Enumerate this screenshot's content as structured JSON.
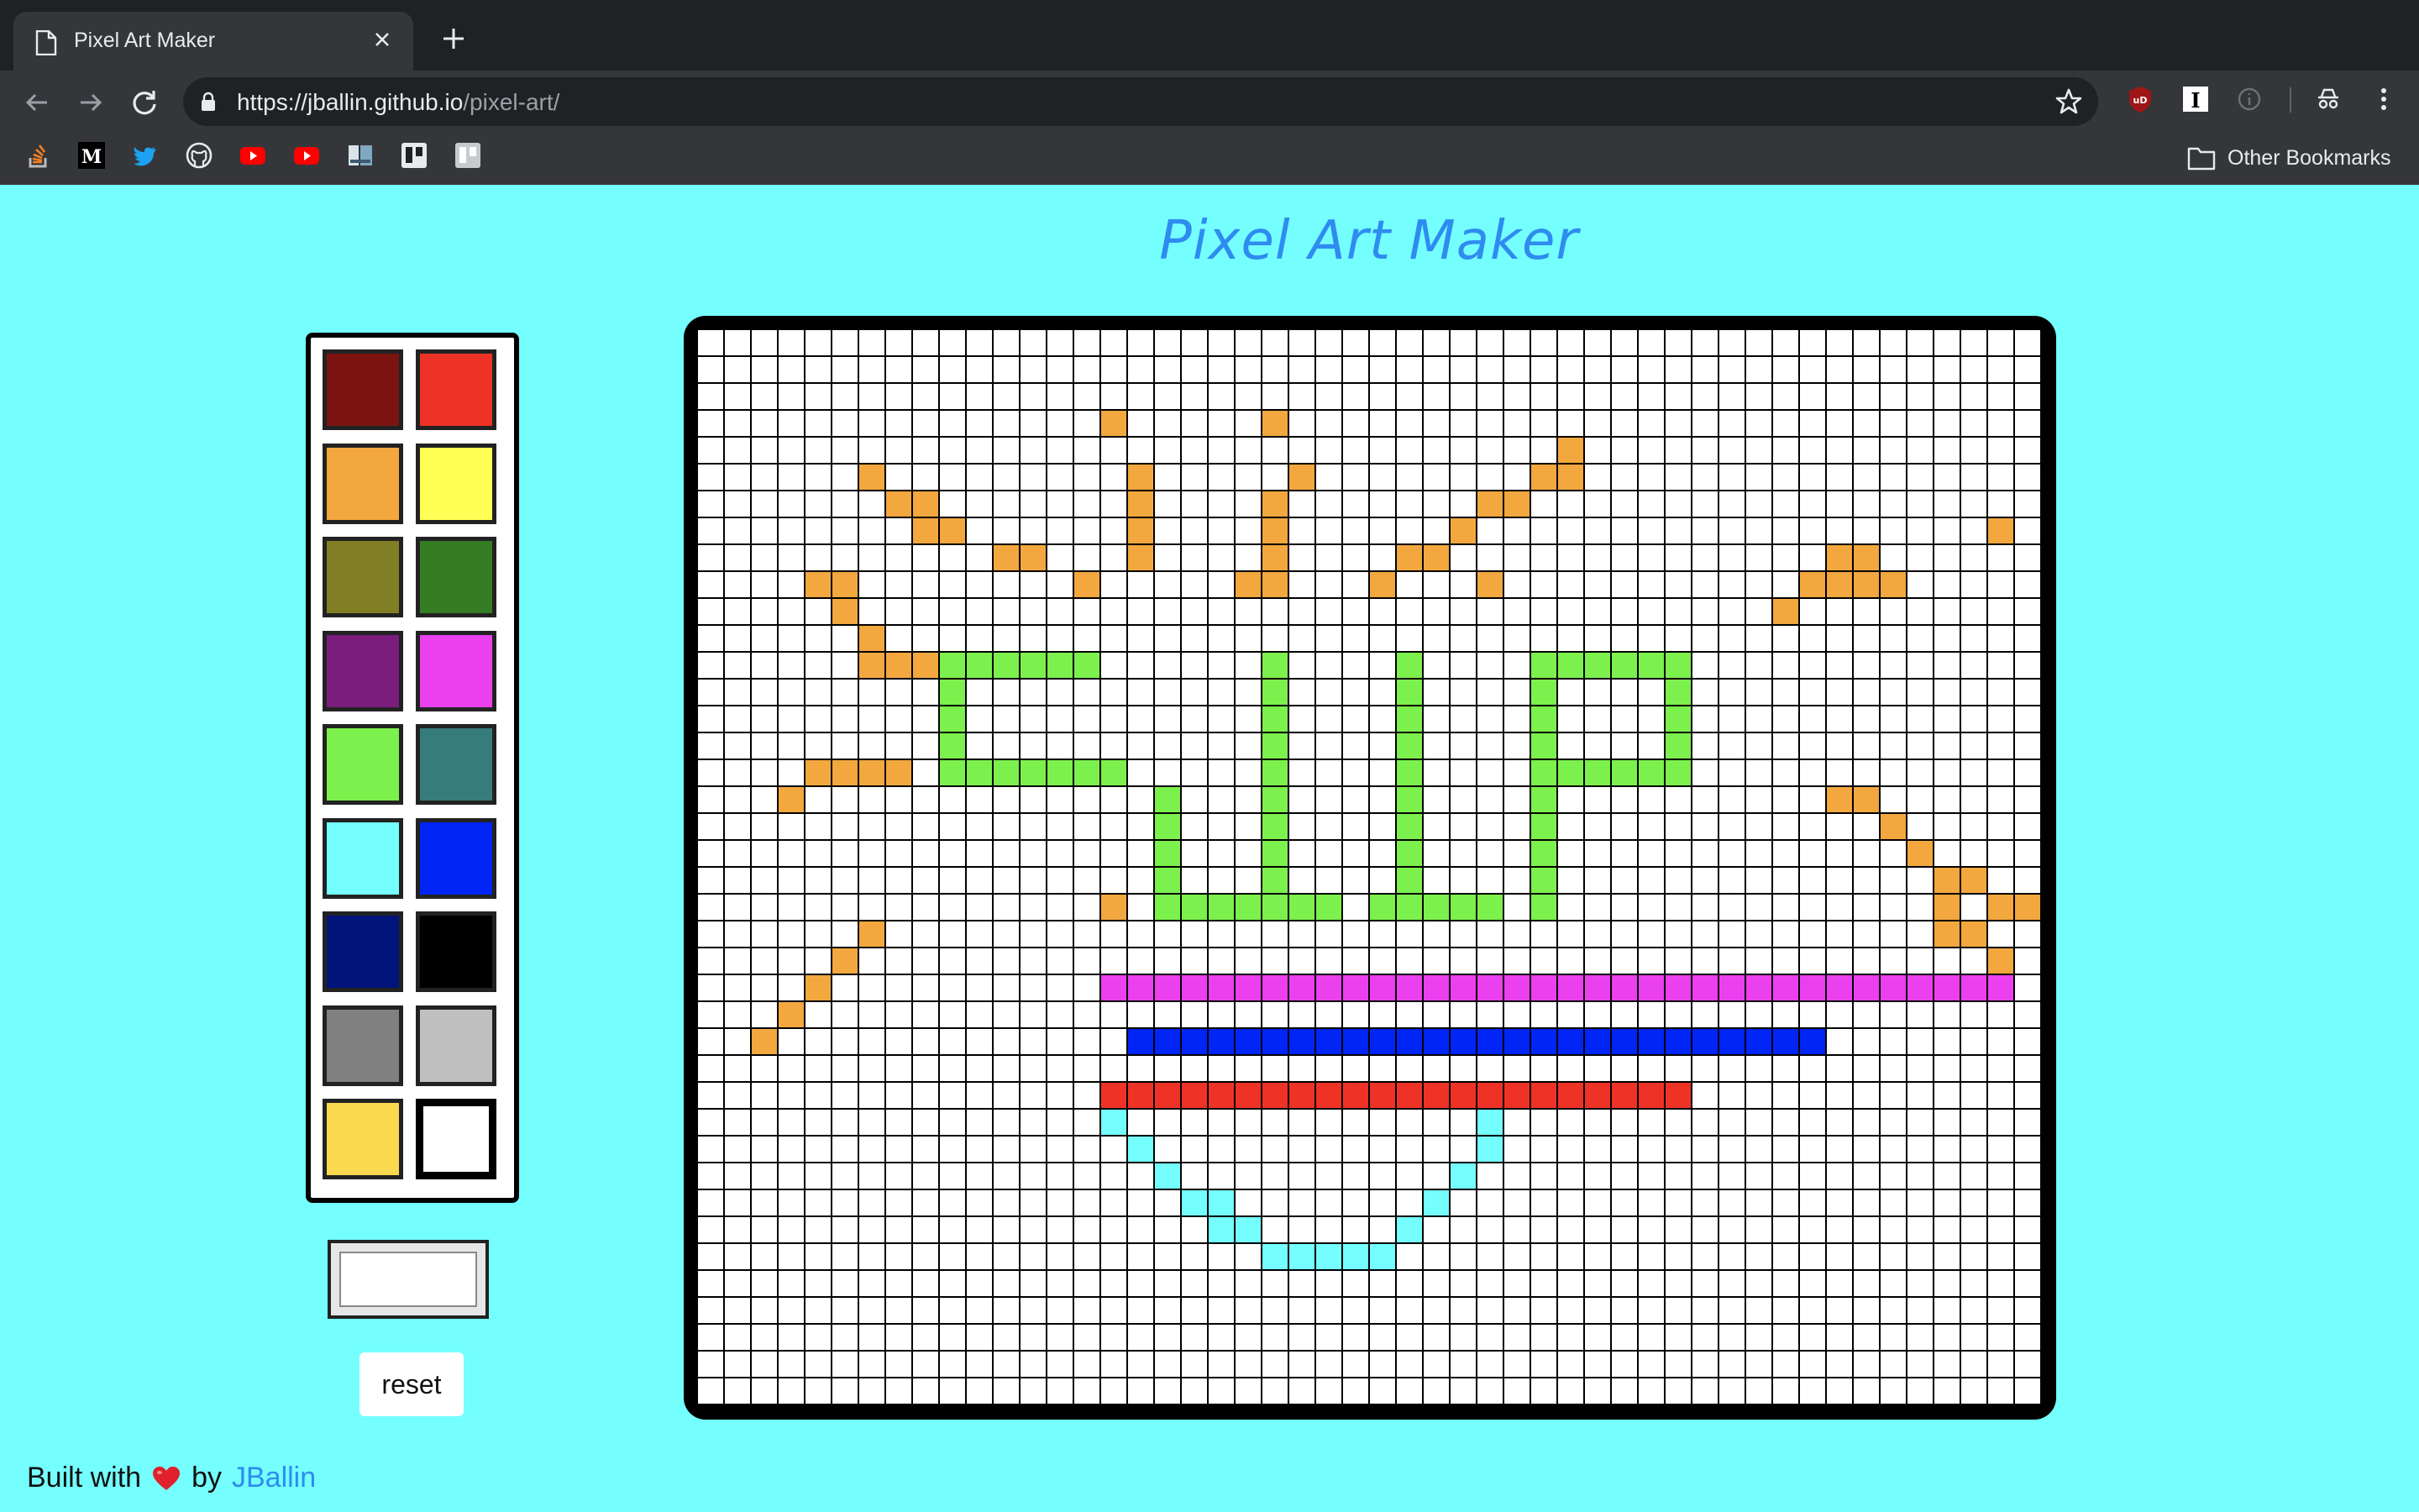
{
  "browser": {
    "tab_title": "Pixel Art Maker",
    "url_host": "https://jballin.github.io",
    "url_path": "/pixel-art/",
    "other_bookmarks": "Other Bookmarks"
  },
  "page": {
    "title": "Pixel Art Maker",
    "reset_label": "reset",
    "footer_text": "Built with",
    "footer_by": "by",
    "footer_author": "JBallin"
  },
  "palette": [
    "#7B1411",
    "#EE3326",
    "#F3A73F",
    "#FFFF55",
    "#807F26",
    "#357C22",
    "#7A1D7D",
    "#EA40EE",
    "#7CF04C",
    "#367C7B",
    "#74FEFD",
    "#0025F5",
    "#00147A",
    "#000000",
    "#808080",
    "#C0C0C0",
    "#FAD94E",
    "#FFFFFF"
  ],
  "current_color": "#FFFFFF",
  "colors": {
    "O": "#F3A73F",
    "G": "#7CF04C",
    "M": "#EA40EE",
    "B": "#0025F5",
    "R": "#EE3326",
    "C": "#74FEFD"
  },
  "grid": {
    "cols": 50,
    "rows": 40,
    "rows_data": [
      "..................................................",
      "..................................................",
      "..................................................",
      "...............O.....O............................",
      "................................O.................",
      "......O.........O.....O........OO.................",
      ".......OO.......O....O.......OO...................",
      "........OO......O....O......O...................O.",
      "...........OO...O....O....OO..............OO......",
      "....OO........O.....OO...O...O...........OOOO.....",
      ".....O..................................O..........",
      "......O...........................................",
      "......OOOGGGGGG......G....G....GGGGGG.............",
      ".........G...........G....G....G....G.............",
      ".........G...........G....G....G....G.............",
      ".........G...........G....G....G....G.............",
      "....OOOO.GGGGGGG.....G....G....GGGGGG.............",
      "...O.............G...G....G....G..........OO......",
      ".................G...G....G....G............O.....",
      ".................G...G....G....G.............O....",
      ".................G...G....G....G..............OO..",
      "...............O.GGGGGGG.GGGGG.G..............O.OO",
      "......O.......................................OO..",
      ".....O..........................................O.",
      "....O..........MMMMMMMMMMMMMMMMMMMMMMMMMMMMMMMMMM...",
      "...O..............................................",
      "..O.............BBBBBBBBBBBBBBBBBBBBBBBBBB.........",
      "..................................................",
      "...............RRRRRRRRRRRRRRRRRRRRRR.............",
      "...............C.............C....................",
      "................C............C....................",
      ".................C..........C.....................",
      "..................CC.......C......................",
      "...................CC.....C.......................",
      ".....................CCCCC........................",
      "..................................................",
      "..................................................",
      "..................................................",
      "..................................................",
      ".................................................."
    ]
  }
}
